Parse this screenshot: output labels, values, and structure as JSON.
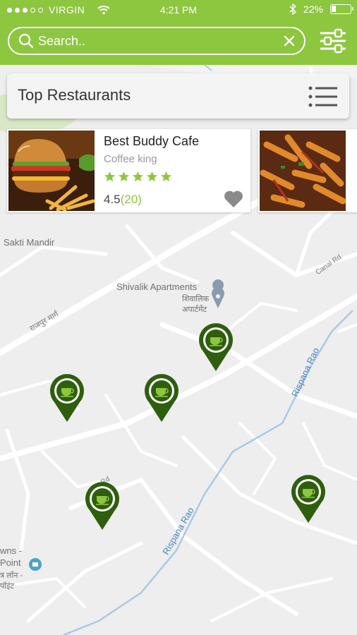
{
  "status_bar": {
    "carrier": "VIRGIN",
    "time": "4:21 PM",
    "battery_text": "22%",
    "battery_level": 0.22
  },
  "search": {
    "placeholder": "Search.."
  },
  "top_section": {
    "title": "Top Restaurants"
  },
  "restaurants": [
    {
      "name": "Best Buddy Cafe",
      "subtitle": "Coffee king",
      "stars": 5,
      "rating": "4.5",
      "reviews": "(20)"
    }
  ],
  "map": {
    "places": [
      "Sakti Mandir",
      "Shivalik Apartments",
      "शिवालिक",
      "अपार्टमेंट",
      "Canal Rd",
      "राजपुर मार्ग",
      "Rd",
      "wns -",
      "Point",
      "त्र लॉन -",
      "पॉइंट"
    ],
    "rivers": [
      "Rispana Rao",
      "Rispana Rao"
    ]
  },
  "colors": {
    "brand_green": "#8dc63f",
    "pin_green": "#2e5e0e",
    "star_green": "#8dc63f"
  },
  "icons": {
    "search": "search-icon",
    "clear": "close-icon",
    "filter": "sliders-icon",
    "list": "list-icon",
    "heart": "heart-icon",
    "pin": "coffee-cup-icon"
  }
}
